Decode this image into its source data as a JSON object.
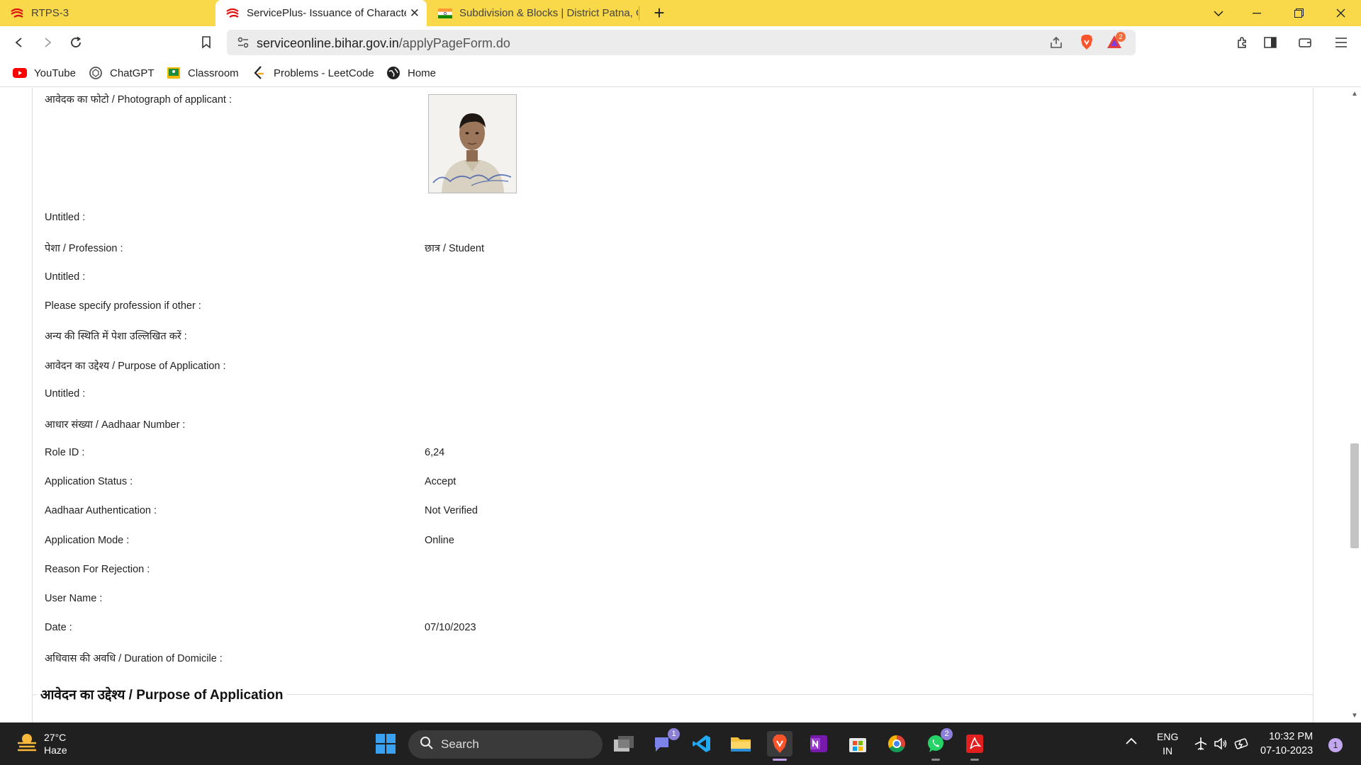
{
  "browser": {
    "tabs": [
      {
        "title": "RTPS-3"
      },
      {
        "title": "ServicePlus- Issuance of Characte"
      },
      {
        "title": "Subdivision & Blocks | District Patna, G"
      }
    ],
    "url_host": "serviceonline.bihar.gov.in",
    "url_path": "/applyPageForm.do",
    "brave_badge_count": "2",
    "bookmarks": [
      "YouTube",
      "ChatGPT",
      "Classroom",
      "Problems - LeetCode",
      "Home"
    ]
  },
  "form": {
    "photo_label": "आवेदक का फोटो / Photograph of applicant :",
    "rows": [
      {
        "label": "Untitled :",
        "value": ""
      },
      {
        "label": "पेशा / Profession :",
        "value": "छात्र / Student"
      },
      {
        "label": "Untitled :",
        "value": ""
      },
      {
        "label": "Please specify profession if other :",
        "value": ""
      },
      {
        "label": "अन्य की स्थिति में पेशा उल्लिखित करें :",
        "value": ""
      },
      {
        "label": "आवेदन का उद्देश्य / Purpose of Application :",
        "value": ""
      },
      {
        "label": "Untitled :",
        "value": ""
      },
      {
        "label": "आधार संख्या / Aadhaar Number :",
        "value": ""
      },
      {
        "label": "Role ID :",
        "value": "6,24"
      },
      {
        "label": "Application Status :",
        "value": "Accept"
      },
      {
        "label": "Aadhaar Authentication :",
        "value": "Not Verified"
      },
      {
        "label": "Application Mode :",
        "value": "Online"
      },
      {
        "label": "Reason For Rejection :",
        "value": ""
      },
      {
        "label": "User Name :",
        "value": ""
      },
      {
        "label": "Date :",
        "value": "07/10/2023"
      },
      {
        "label": "अधिवास की अवधि / Duration of Domicile :",
        "value": ""
      }
    ],
    "next_section_title": "आवेदन का उद्देश्य / Purpose of Application"
  },
  "taskbar": {
    "weather_temp": "27°C",
    "weather_desc": "Haze",
    "search_label": "Search",
    "teams_badge": "1",
    "whatsapp_badge": "2",
    "lang_top": "ENG",
    "lang_bottom": "IN",
    "time": "10:32 PM",
    "date": "07-10-2023",
    "notification_count": "1"
  },
  "colors": {
    "tabstrip": "#f9d849",
    "taskbar": "#202020",
    "brave_orange": "#fb542b"
  }
}
